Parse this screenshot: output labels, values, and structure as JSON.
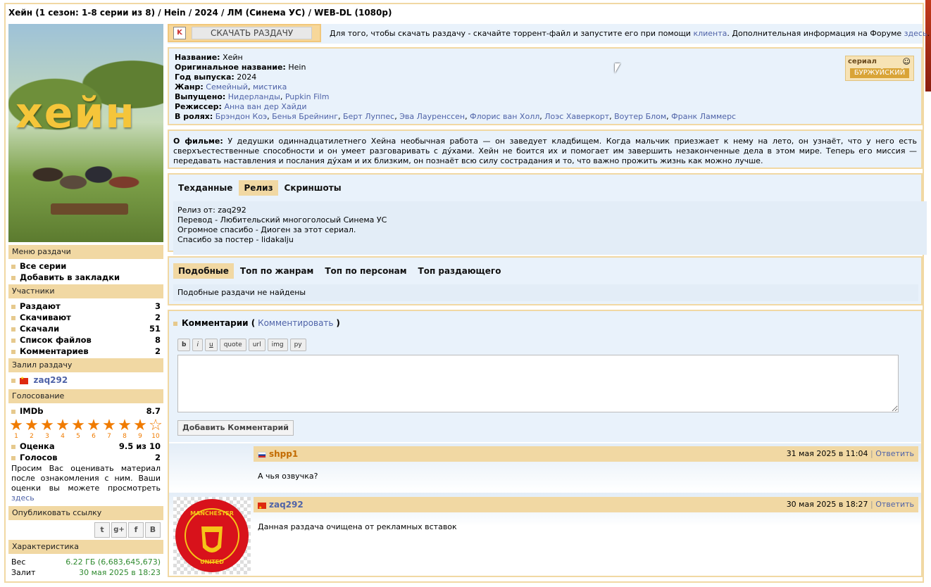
{
  "page_title": "Хейн (1 сезон: 1-8 серии из 8) / Hein / 2024 / ЛМ (Синема УС) / WEB-DL (1080p)",
  "poster": {
    "title_text": "хейн"
  },
  "download": {
    "button_label": "СКАЧАТЬ РАЗДАЧУ",
    "text": "Для того, чтобы скачать раздачу - скачайте торрент-файл и запустите его при помощи",
    "client_link": "клиента",
    "text2": ". Дополнительная информация на Форуме",
    "here_link": "здесь",
    "end": "."
  },
  "info": {
    "name_label": "Название:",
    "name": "Хейн",
    "orig_label": "Оригинальное название:",
    "orig": "Hein",
    "year_label": "Год выпуска:",
    "year": "2024",
    "genre_label": "Жанр:",
    "genres": [
      "Семейный",
      "мистика"
    ],
    "released_label": "Выпущено:",
    "released": [
      "Нидерланды",
      "Pupkin Film"
    ],
    "director_label": "Режиссер:",
    "director": "Анна ван дер Хайди",
    "cast_label": "В ролях:",
    "cast": [
      "Брэндон Коэ",
      "Бенья Брейнинг",
      "Берт Луппес",
      "Эва Лауренссен",
      "Флорис ван Холл",
      "Лоэс Хаверкорт",
      "Воутер Блом",
      "Франк Ламмерс"
    ],
    "badge_top": "сериал",
    "badge_bottom": "БУРЖУЙСКИЙ"
  },
  "about": {
    "label": "О фильме:",
    "text": "У дедушки одиннадцатилетнего Хейна необычная работа — он заведует кладбищем. Когда мальчик приезжает к нему на лето, он узнаёт, что у него есть сверхъестественные способности и он умеет разговаривать с дýхами. Хейн не боится их и помогает им завершить незаконченные дела в этом мире. Теперь его миссия — передавать наставления и послания дýхам и их близким, он познаёт всю силу сострадания и то, что важно прожить жизнь как можно лучше."
  },
  "release_tabs": [
    "Техданные",
    "Релиз",
    "Скриншоты"
  ],
  "release_lines": [
    "Релиз от: zaq292",
    "Перевод - Любительский многоголосый Синема УС",
    "Огромное спасибо - Диоген за этот сериал.",
    "Спасибо за постер - lidakalju"
  ],
  "similar_tabs": [
    "Подобные",
    "Топ по жанрам",
    "Топ по персонам",
    "Топ раздающего"
  ],
  "similar_text": "Подобные раздачи не найдены",
  "comments": {
    "title": "Комментарии (",
    "link": "Комментировать",
    "close": ")",
    "buttons": [
      "b",
      "i",
      "u",
      "quote",
      "url",
      "img",
      "ру"
    ],
    "submit": "Добавить Комментарий",
    "items": [
      {
        "user": "shpp1",
        "date": "31 мая 2025 в 11:04",
        "sep": "|",
        "reply": "Ответить",
        "text": "А чья озвучка?"
      },
      {
        "user": "zaq292",
        "date": "30 мая 2025 в 18:27",
        "sep": "|",
        "reply": "Ответить",
        "text": "Данная раздача очищена от рекламных вставок"
      }
    ],
    "avatar_top": "MANCHESTER",
    "avatar_bottom": "UNITED"
  },
  "sidebar": {
    "menu_header": "Меню раздачи",
    "menu_items": [
      "Все серии",
      "Добавить в закладки"
    ],
    "participants_header": "Участники",
    "participants": [
      {
        "label": "Раздают",
        "value": "3"
      },
      {
        "label": "Скачивают",
        "value": "2"
      },
      {
        "label": "Скачали",
        "value": "51"
      },
      {
        "label": "Список файлов",
        "value": "8"
      },
      {
        "label": "Комментариев",
        "value": "2"
      }
    ],
    "uploader_header": "Залил раздачу",
    "uploader": "zaq292",
    "vote_header": "Голосование",
    "imdb_label": "IMDb",
    "imdb_value": "8.7",
    "star_numbers": [
      "1",
      "2",
      "3",
      "4",
      "5",
      "6",
      "7",
      "8",
      "9",
      "10"
    ],
    "star_fill": 0.95,
    "rating_label": "Оценка",
    "rating_value": "9.5 из 10",
    "votes_label": "Голосов",
    "votes_value": "2",
    "vote_note": "Просим Вас оценивать материал после ознакомления с ним. Ваши оценки вы можете просмотреть",
    "vote_note_link": "здесь",
    "share_header": "Опубликовать ссылку",
    "share_buttons": [
      "t",
      "g+",
      "f",
      "B"
    ],
    "char_header": "Характеристика",
    "size_label": "Вес",
    "size_value": "6.22 ГБ (6,683,645,673)",
    "uploaded_label": "Залит",
    "uploaded_value": "30 мая 2025 в 18:23"
  },
  "colors": {
    "accent": "#f1d8a3",
    "link": "#4f63a8",
    "green": "#2f8a2f",
    "blue_panel": "#e9f2fb",
    "star": "#f07b00"
  }
}
